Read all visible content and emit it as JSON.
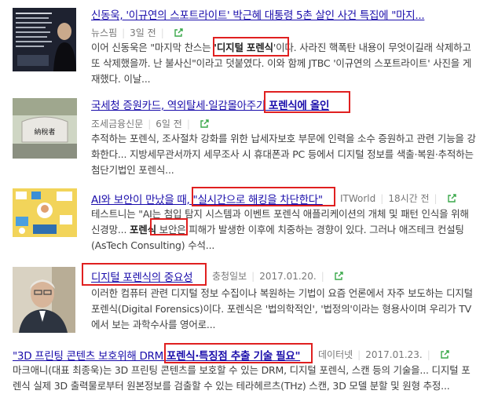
{
  "results": [
    {
      "title": "신동욱, '이규연의 스포트라이트' 박근혜 대통령 5촌 살인 사건 특집에 \"마지...",
      "source": "뉴스핌",
      "time": "3일 전",
      "desc_pre": "이어 신동욱은 \"마지막 찬스는 ",
      "desc_hl": "'디지털 포렌식",
      "desc_post": "'이다. 사라진 핵폭탄 내용이 무엇이길래 삭제하고 또 삭제했을까. 난 불사신\"이라고 덧붙였다. 이와 함께 JTBC '이규연의 스포트라이트' 사진을 게재했다. 이날..."
    },
    {
      "title_pre": "국세청 증원카드, 역외탈세·일감몰아주기 ",
      "title_hl": "포렌식에 올인",
      "source": "조세금융신문",
      "time": "6일 전",
      "desc": "추적하는 포렌식, 조사절차 강화를 위한 납세자보호 부문에 인력을 소수 증원하고 관련 기능을 강화한다... 지방세무관서까지 세무조사 시 휴대폰과 PC 등에서 디지털 정보를 색출·복원·추적하는 첨단기법인 포렌식..."
    },
    {
      "title_pre": "AI와 보안이 만났을 때, ",
      "title_hl": "\"실시간으로 해킹을 차단한다\"",
      "source": "ITWorld",
      "time": "18시간 전",
      "desc_pre": "테스트니는 \"AI는 첨입 탐지 시스템과 이벤트 포렌식 애플리케이션의 개체 및 패턴 인식을 위해 신경망... ",
      "desc_hl": "포렌식",
      "desc_post": " 보안은 피해가 발생한 이후에 치중하는 경향이 있다. 그러나 애즈테크 컨설팅(AsTech Consulting) 수석..."
    },
    {
      "title": "디지털 포렌식의 중요성",
      "source": "충청일보",
      "time": "2017.01.20.",
      "desc": "이러한 컴퓨터 관련 디지털 정보 수집이나 복원하는 기법이 요즘 언론에서 자주 보도하는 디지털 포렌식(Digital Forensics)이다. 포렌식은 '법의학적인', '법정의'이라는 형용사이며 우리가 TV에서 보는 과학수사를 영어로..."
    },
    {
      "title_pre": "\"3D 프린팅 콘텐츠 보호위해 DRM ",
      "title_hl": "포렌식·특징점 추출 기술 필요\"",
      "source": "데이터넷",
      "time": "2017.01.23.",
      "desc": "마크애니(대표 최종욱)는 3D 프린팅 콘텐츠를 보호할 수 있는 DRM, 디지털 포렌식, 스캔 등의 기술을... 디지털 포렌식 실제 3D 출력물로부터 원본정보를 검출할 수 있는 테라헤르츠(THz) 스캔, 3D 모델 분할 및 원형 추정..."
    },
    {
      "thumb2_text": "納稅者"
    }
  ],
  "icons": {
    "share": "external-link-icon"
  },
  "colors": {
    "title": "#1a0dab",
    "highlight": "#e02020",
    "meta": "#777777",
    "share": "#3aa84a"
  }
}
